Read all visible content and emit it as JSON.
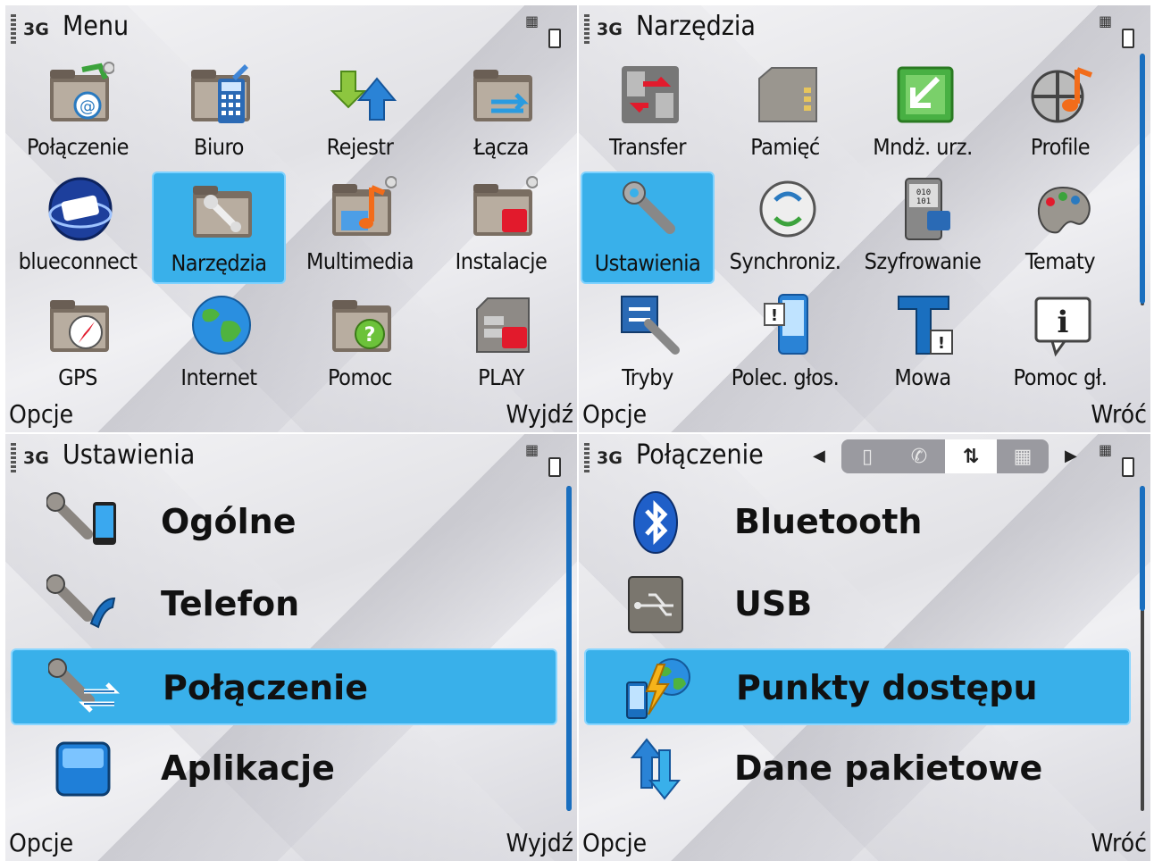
{
  "screens": {
    "menu": {
      "tech": "3G",
      "title": "Menu",
      "items": [
        {
          "label": "Połączenie",
          "icon": "folder-email-icon"
        },
        {
          "label": "Biuro",
          "icon": "folder-calculator-icon"
        },
        {
          "label": "Rejestr",
          "icon": "log-arrows-icon"
        },
        {
          "label": "Łącza",
          "icon": "folder-links-icon"
        },
        {
          "label": "blueconnect",
          "icon": "blueconnect-logo-icon"
        },
        {
          "label": "Narzędzia",
          "icon": "folder-wrench-icon"
        },
        {
          "label": "Multimedia",
          "icon": "folder-music-icon"
        },
        {
          "label": "Instalacje",
          "icon": "folder-install-icon"
        },
        {
          "label": "GPS",
          "icon": "folder-compass-icon"
        },
        {
          "label": "Internet",
          "icon": "globe-icon"
        },
        {
          "label": "Pomoc",
          "icon": "folder-help-icon"
        },
        {
          "label": "PLAY",
          "icon": "sim-card-icon"
        }
      ],
      "selected_index": 5,
      "left_softkey": "Opcje",
      "right_softkey": "Wyjdź"
    },
    "narzedzia": {
      "tech": "3G",
      "title": "Narzędzia",
      "items": [
        {
          "label": "Transfer",
          "icon": "transfer-icon"
        },
        {
          "label": "Pamięć",
          "icon": "memory-card-icon"
        },
        {
          "label": "Mndż. urz.",
          "icon": "device-manager-icon"
        },
        {
          "label": "Profile",
          "icon": "profiles-icon"
        },
        {
          "label": "Ustawienia",
          "icon": "wrench-icon"
        },
        {
          "label": "Synchroniz.",
          "icon": "sync-icon"
        },
        {
          "label": "Szyfrowanie",
          "icon": "encryption-icon"
        },
        {
          "label": "Tematy",
          "icon": "palette-icon"
        },
        {
          "label": "Tryby",
          "icon": "modes-icon"
        },
        {
          "label": "Polec. głos.",
          "icon": "voice-commands-icon"
        },
        {
          "label": "Mowa",
          "icon": "speech-icon"
        },
        {
          "label": "Pomoc gł.",
          "icon": "info-icon"
        }
      ],
      "selected_index": 4,
      "left_softkey": "Opcje",
      "right_softkey": "Wróć"
    },
    "ustawienia": {
      "tech": "3G",
      "title": "Ustawienia",
      "items": [
        {
          "label": "Ogólne",
          "icon": "wrench-phone-icon"
        },
        {
          "label": "Telefon",
          "icon": "wrench-handset-icon"
        },
        {
          "label": "Połączenie",
          "icon": "wrench-arrows-icon"
        },
        {
          "label": "Aplikacje",
          "icon": "application-icon"
        }
      ],
      "selected_index": 2,
      "left_softkey": "Opcje",
      "right_softkey": "Wyjdź"
    },
    "polaczenie": {
      "tech": "3G",
      "title": "Połączenie",
      "items": [
        {
          "label": "Bluetooth",
          "icon": "bluetooth-icon"
        },
        {
          "label": "USB",
          "icon": "usb-icon"
        },
        {
          "label": "Punkty dostępu",
          "icon": "access-point-icon"
        },
        {
          "label": "Dane pakietowe",
          "icon": "packet-data-icon"
        }
      ],
      "selected_index": 2,
      "tabs": [
        "phone-tab-icon",
        "call-tab-icon",
        "connection-tab-icon",
        "apps-tab-icon"
      ],
      "active_tab": 2,
      "left_softkey": "Opcje",
      "right_softkey": "Wróć"
    }
  },
  "colors": {
    "selection": "#39b0ea",
    "scrollbar": "#1a6fbf"
  }
}
